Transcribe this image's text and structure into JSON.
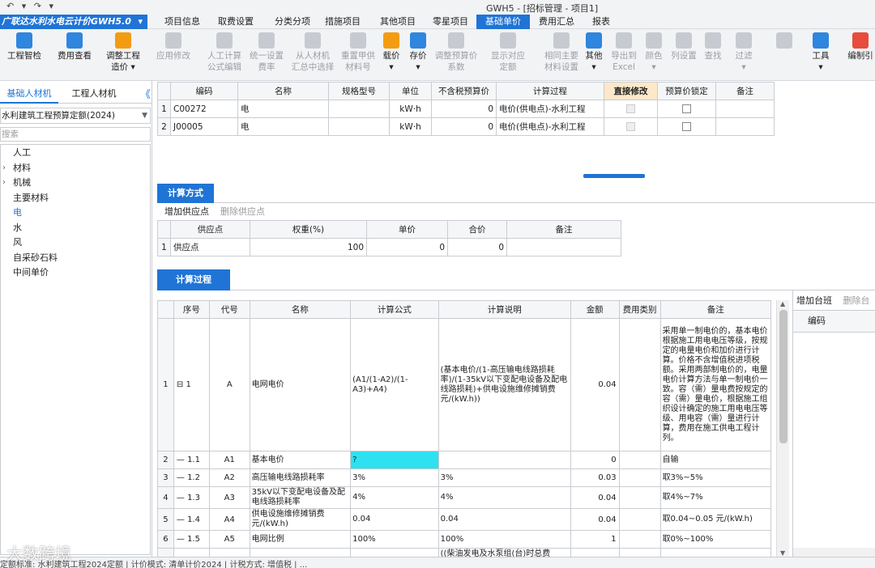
{
  "window": {
    "title": "GWH5 - [招标管理 - 项目1]",
    "quick_access": "↶ ▾ ↷ ▾"
  },
  "app_button": {
    "label": "广联达水利水电云计价GWH5.0"
  },
  "menu_tabs": [
    {
      "label": "项目信息"
    },
    {
      "label": "取费设置"
    },
    {
      "label": "分类分项"
    },
    {
      "label": "措施项目"
    },
    {
      "label": "其他项目"
    },
    {
      "label": "零星项目"
    },
    {
      "label": "基础单价"
    },
    {
      "label": "费用汇总"
    },
    {
      "label": "报表"
    }
  ],
  "active_menu_tab": "基础单价",
  "toolbar": [
    {
      "label": "工程智检",
      "icon": "check-icon",
      "enabled": true
    },
    {
      "label": "费用查看",
      "icon": "magnifier-icon",
      "enabled": true
    },
    {
      "label": "调整工程\n造价 ▾",
      "icon": "adjust-cost-icon",
      "enabled": true
    },
    {
      "label": "应用修改",
      "icon": "apply-icon",
      "enabled": false
    },
    {
      "label": "人工计算\n公式编辑",
      "icon": "formula-icon",
      "enabled": false
    },
    {
      "label": "统一设置\n费率",
      "icon": "rate-icon",
      "enabled": false
    },
    {
      "label": "从人材机\n汇总中选择",
      "icon": "select-icon",
      "enabled": false
    },
    {
      "label": "重置甲供\n材料号",
      "icon": "reset-icon",
      "enabled": false
    },
    {
      "label": "载价\n▾",
      "icon": "load-price-icon",
      "enabled": true
    },
    {
      "label": "存价\n▾",
      "icon": "save-price-icon",
      "enabled": true
    },
    {
      "label": "调整预算价\n系数",
      "icon": "coef-icon",
      "enabled": false
    },
    {
      "label": "显示对应\n定额",
      "icon": "quota-icon",
      "enabled": false
    },
    {
      "label": "相同主要\n材料设置",
      "icon": "material-icon",
      "enabled": false
    },
    {
      "label": "其他\n▾",
      "icon": "grid-icon",
      "enabled": true
    },
    {
      "label": "导出到\nExcel",
      "icon": "excel-icon",
      "enabled": false
    },
    {
      "label": "颜色\n▾",
      "icon": "color-icon",
      "enabled": false
    },
    {
      "label": "列设置",
      "icon": "column-icon",
      "enabled": false
    },
    {
      "label": "查找",
      "icon": "binoculars-icon",
      "enabled": false
    },
    {
      "label": "过滤\n▾",
      "icon": "filter-icon",
      "enabled": false
    },
    {
      "label": "",
      "icon": "arrow-up-icon",
      "enabled": false
    },
    {
      "label": "工具\n▾",
      "icon": "tools-icon",
      "enabled": true
    },
    {
      "label": "编制引",
      "icon": "new-icon",
      "enabled": true
    }
  ],
  "left_panel": {
    "tabs": [
      {
        "label": "基础人材机"
      },
      {
        "label": "工程人材机"
      }
    ],
    "collapse_glyph": "《",
    "quota_select": "水利建筑工程预算定额(2024)",
    "search_placeholder": "搜索",
    "tree": [
      {
        "label": "人工",
        "arrow": ""
      },
      {
        "label": "材料",
        "arrow": "›"
      },
      {
        "label": "机械",
        "arrow": "›"
      },
      {
        "label": "主要材料",
        "arrow": ""
      },
      {
        "label": "电",
        "arrow": ""
      },
      {
        "label": "水",
        "arrow": ""
      },
      {
        "label": "风",
        "arrow": ""
      },
      {
        "label": "自采砂石料",
        "arrow": ""
      },
      {
        "label": "中间单价",
        "arrow": ""
      }
    ],
    "selected": "电"
  },
  "price_grid": {
    "headers": [
      "编码",
      "名称",
      "规格型号",
      "单位",
      "不含税预算价",
      "计算过程",
      "直接修改",
      "预算价锁定",
      "备注"
    ],
    "rows": [
      {
        "no": "1",
        "code": "C00272",
        "name": "电",
        "spec": "",
        "unit": "kW·h",
        "price": "0",
        "process": "电价(供电点)-水利工程"
      },
      {
        "no": "2",
        "code": "J00005",
        "name": "电",
        "spec": "",
        "unit": "kW·h",
        "price": "0",
        "process": "电价(供电点)-水利工程"
      }
    ]
  },
  "calc_method": {
    "tab": "计算方式",
    "actions": [
      "增加供应点",
      "删除供应点"
    ],
    "headers": [
      "供应点",
      "权重(%)",
      "单价",
      "合价",
      "备注"
    ],
    "rows": [
      {
        "no": "1",
        "point": "供应点",
        "weight": "100",
        "price": "0",
        "total": "0",
        "note": ""
      }
    ]
  },
  "calc_process": {
    "tab": "计算过程",
    "headers": [
      "序号",
      "代号",
      "名称",
      "计算公式",
      "计算说明",
      "金额",
      "费用类别",
      "备注"
    ],
    "rows": [
      {
        "no": "1",
        "seq": "⊟ 1",
        "code": "A",
        "name": "电网电价",
        "formula": "(A1/(1-A2)/(1-A3)+A4)",
        "desc": "(基本电价/(1-高压输电线路损耗率)/(1-35kV以下变配电设备及配电线路损耗)+供电设施维修摊销费 元/(kW.h))",
        "amount": "0.04",
        "type": "",
        "note": "采用单一制电价的，基本电价根据施工用电电压等级，按规定的电量电价和加价进行计算。价格不含增值税进项税额。采用两部制电价的，电量电价计算方法与单一制电价一致。容（需）量电费按规定的容（需）量电价，根据施工组织设计确定的施工用电电压等级、用电容（需）量进行计算，费用在施工供电工程计列。"
      },
      {
        "no": "2",
        "seq": "— 1.1",
        "code": "A1",
        "name": "基本电价",
        "formula": "?",
        "desc": "",
        "amount": "0",
        "type": "",
        "note": "自输"
      },
      {
        "no": "3",
        "seq": "— 1.2",
        "code": "A2",
        "name": "高压输电线路损耗率",
        "formula": "3%",
        "desc": "3%",
        "amount": "0.03",
        "type": "",
        "note": "取3%~5%"
      },
      {
        "no": "4",
        "seq": "— 1.3",
        "code": "A3",
        "name": "35kV以下变配电设备及配电线路损耗率",
        "formula": "4%",
        "desc": "4%",
        "amount": "0.04",
        "type": "",
        "note": "取4%~7%"
      },
      {
        "no": "5",
        "seq": "— 1.4",
        "code": "A4",
        "name": "供电设施维修摊销费 元/(kW.h)",
        "formula": "0.04",
        "desc": "0.04",
        "amount": "0.04",
        "type": "",
        "note": "取0.04~0.05 元/(kW.h)"
      },
      {
        "no": "6",
        "seq": "— 1.5",
        "code": "A5",
        "name": "电网比例",
        "formula": "100%",
        "desc": "100%",
        "amount": "1",
        "type": "",
        "note": "取0%~100%"
      },
      {
        "no": "",
        "seq": "",
        "code": "",
        "name": "",
        "formula": "",
        "desc": "((柴油发电及水泵组(台)时总费用/(柴油发电机额定",
        "amount": "",
        "type": "",
        "note": ""
      }
    ]
  },
  "right_panel": {
    "actions": [
      "增加台班",
      "删除台"
    ],
    "header": "编码"
  },
  "status_bar": "定额标准: 水利建筑工程2024定额  |  计价模式: 清单计价2024  |  计税方式: 增值税  |  ...",
  "watermark": "大数跨境",
  "colors": {
    "accent": "#1f74d6",
    "highlight_cell": "#2de1f0",
    "header_highlight": "#fde9c9"
  }
}
